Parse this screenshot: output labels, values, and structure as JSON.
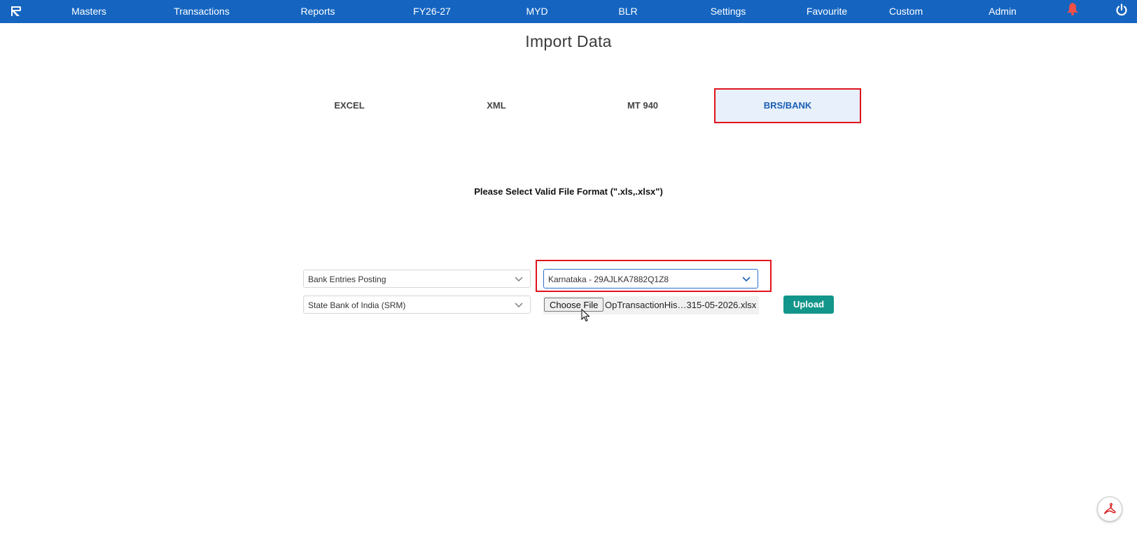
{
  "nav": {
    "items": [
      {
        "label": "Masters"
      },
      {
        "label": "Transactions"
      },
      {
        "label": "Reports"
      },
      {
        "label": "FY26-27"
      },
      {
        "label": "MYD"
      },
      {
        "label": "BLR"
      },
      {
        "label": "Settings"
      },
      {
        "label": "Favourite"
      },
      {
        "label": "Custom"
      },
      {
        "label": "Admin"
      }
    ],
    "icons": {
      "logo": "app-logo-icon",
      "bell": "bell-icon",
      "power": "power-icon"
    }
  },
  "page": {
    "title": "Import Data"
  },
  "tabs": [
    {
      "label": "EXCEL",
      "active": false
    },
    {
      "label": "XML",
      "active": false
    },
    {
      "label": "MT 940",
      "active": false
    },
    {
      "label": "BRS/BANK",
      "active": true
    }
  ],
  "hint": "Please Select Valid File Format (\".xls,.xlsx\")",
  "form": {
    "posting_type": "Bank Entries Posting",
    "gstin": "Karnataka - 29AJLKA7882Q1Z8",
    "bank": "State Bank of India (SRM)",
    "choose_file_label": "Choose File",
    "file_name": "OpTransactionHis…315-05-2026.xlsx",
    "upload_label": "Upload"
  },
  "colors": {
    "nav_bg": "#1565c0",
    "highlight": "#e0141e",
    "active_tab_bg": "#e8f0fb",
    "upload_bg": "#12958a",
    "bell": "#f0504a"
  },
  "fab": {
    "icon": "pdf-icon"
  }
}
